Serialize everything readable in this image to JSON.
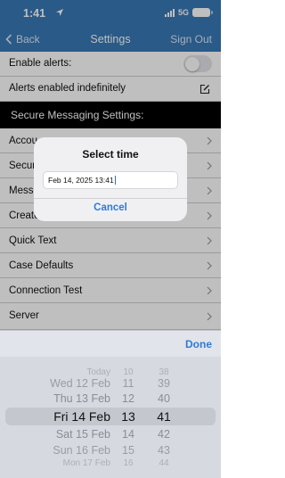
{
  "status_bar": {
    "time": "1:41",
    "network": "5G"
  },
  "nav": {
    "back_label": "Back",
    "title": "Settings",
    "signout_label": "Sign Out"
  },
  "settings": {
    "enable_alerts_label": "Enable alerts:",
    "enable_alerts_on": false,
    "alerts_indefinitely_label": "Alerts enabled indefinitely"
  },
  "section": {
    "title": "Secure Messaging Settings:"
  },
  "menu": [
    {
      "label": "Accou"
    },
    {
      "label": "Secur"
    },
    {
      "label": "Messa"
    },
    {
      "label": "Create"
    },
    {
      "label": "Quick Text"
    },
    {
      "label": "Case Defaults"
    },
    {
      "label": "Connection Test"
    },
    {
      "label": "Server"
    }
  ],
  "dialog": {
    "title": "Select time",
    "value": "Feb 14, 2025 13:41",
    "cancel_label": "Cancel"
  },
  "picker": {
    "done_label": "Done",
    "dates": [
      "Today",
      "Wed 12 Feb",
      "Thu 13 Feb",
      "Fri 14 Feb",
      "Sat 15 Feb",
      "Sun 16 Feb",
      "Mon 17 Feb"
    ],
    "hours": [
      "10",
      "11",
      "12",
      "13",
      "14",
      "15",
      "16"
    ],
    "minutes": [
      "38",
      "39",
      "40",
      "41",
      "42",
      "43",
      "44"
    ],
    "selected_date": "Fri 14 Feb",
    "selected_hour": "13",
    "selected_minute": "41"
  },
  "colors": {
    "accent": "#2f7bd6",
    "nav_bar": "#3778b6",
    "section_header": "#000000"
  }
}
